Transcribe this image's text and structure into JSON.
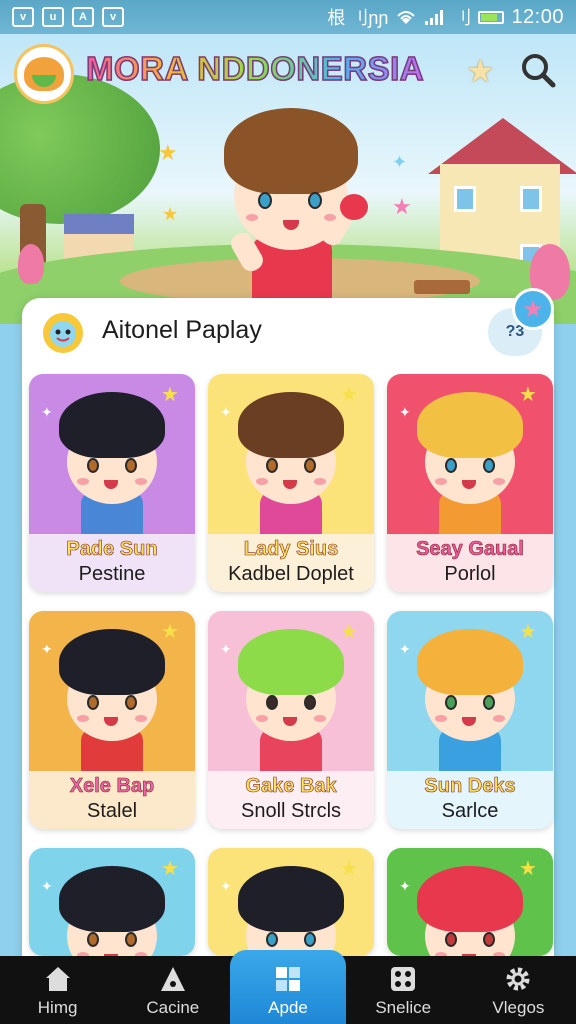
{
  "status_bar": {
    "time": "12:00",
    "signal_text": "根 刂ɲɲ",
    "network_text": "刂",
    "app_icons": [
      "v",
      "u",
      "A",
      "v"
    ]
  },
  "header": {
    "title": "MORA NDDONERSIA",
    "bubble_text": ""
  },
  "panel": {
    "title": "Aitonel Paplay",
    "badge": "?3"
  },
  "cards": [
    {
      "line1": "Pade Sun",
      "line2": "Pestine",
      "bg": "#c98ae6",
      "label_bg": "#f1e3f7",
      "line1_color": "#ffe25a",
      "hair": "#1f1f2a",
      "shirt": "#4a86d6",
      "eye": "#b06a2a"
    },
    {
      "line1": "Lady Sius",
      "line2": "Kadbel  Doplet",
      "bg": "#fbe37a",
      "label_bg": "#fdf0d8",
      "line1_color": "#ffe25a",
      "hair": "#6a3e22",
      "shirt": "#e0489a",
      "eye": "#b06a2a"
    },
    {
      "line1": "Seay Gaual",
      "line2": "Porlol",
      "bg": "#f0526e",
      "label_bg": "#fde4e8",
      "line1_color": "#f1569c",
      "hair": "#f2c042",
      "shirt": "#f39a32",
      "eye": "#3aa0c8"
    },
    {
      "line1": "Xele Bap",
      "line2": "Stalel",
      "bg": "#f3b54a",
      "label_bg": "#fce9cc",
      "line1_color": "#f163a8",
      "hair": "#1f1f2a",
      "shirt": "#e23b3b",
      "eye": "#b06a2a"
    },
    {
      "line1": "Gake Bak",
      "line2": "Snoll Strcls",
      "bg": "#f7c0d6",
      "label_bg": "#fdeef4",
      "line1_color": "#ffe25a",
      "hair": "#8edb4a",
      "shirt": "#e8445e",
      "eye": "#3a2a2a"
    },
    {
      "line1": "Sun Deks",
      "line2": "Sarlce",
      "bg": "#8fd6ef",
      "label_bg": "#e4f5fb",
      "line1_color": "#ffe25a",
      "hair": "#f4b23c",
      "shirt": "#3aa0e0",
      "eye": "#4aa05a"
    },
    {
      "line1": "",
      "line2": "",
      "bg": "#7fd4ec",
      "label_bg": "#e4f5fb",
      "line1_color": "#ffe25a",
      "hair": "#1f1f2a",
      "shirt": "#4a86d6",
      "eye": "#b06a2a"
    },
    {
      "line1": "",
      "line2": "",
      "bg": "#fbe37a",
      "label_bg": "#fdf0d8",
      "line1_color": "#ffe25a",
      "hair": "#1f1f2a",
      "shirt": "#4a86d6",
      "eye": "#3aa0c8"
    },
    {
      "line1": "",
      "line2": "",
      "bg": "#5fc24a",
      "label_bg": "#e6f6df",
      "line1_color": "#ffe25a",
      "hair": "#e8384e",
      "shirt": "#e8445e",
      "eye": "#c23a3a"
    }
  ],
  "nav": [
    {
      "label": "Himg",
      "icon": "home-icon"
    },
    {
      "label": "Cacine",
      "icon": "triangle-icon"
    },
    {
      "label": "Apde",
      "icon": "grid-icon",
      "active": true
    },
    {
      "label": "Snelice",
      "icon": "dice-icon"
    },
    {
      "label": "Vlegos",
      "icon": "gear-icon"
    }
  ]
}
